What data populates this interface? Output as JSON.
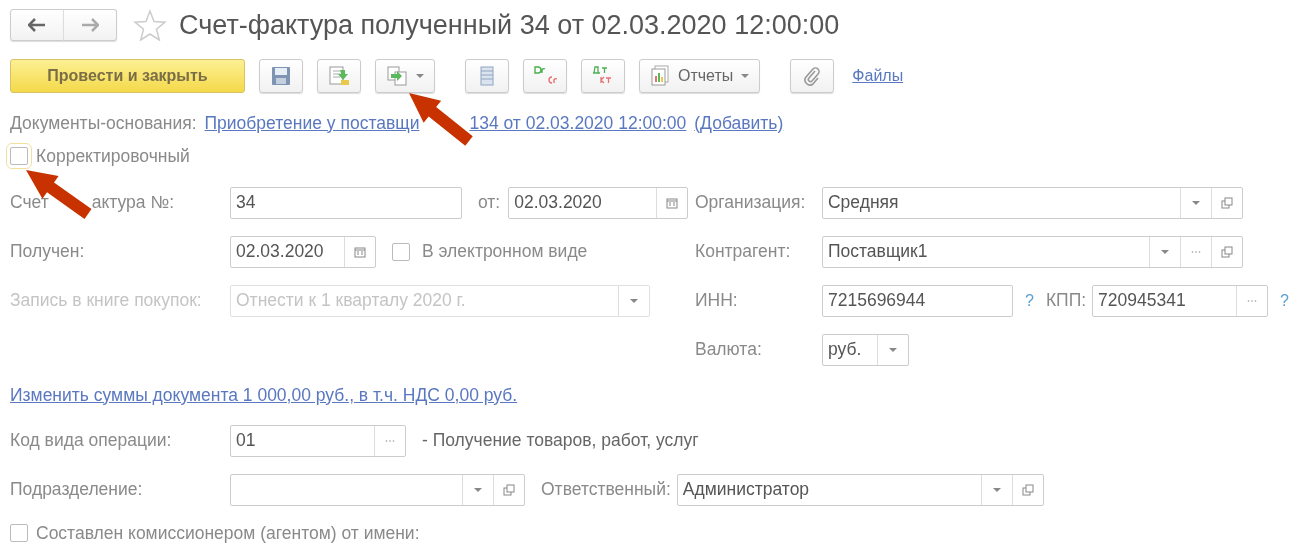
{
  "title": "Счет-фактура полученный 34 от 02.03.2020 12:00:00",
  "toolbar": {
    "primary_button": "Провести и закрыть",
    "reports_button": "Отчеты",
    "files_link": "Файлы"
  },
  "basis": {
    "label": "Документы-основания:",
    "link_start": "Приобретение у поставщи",
    "link_end": "134 от 02.03.2020 12:00:00",
    "add_link": "(Добавить)"
  },
  "corrective": {
    "label": "Корректировочный",
    "checked": false
  },
  "invoice": {
    "label_start": "Счет",
    "label_end": "актура №:",
    "value": "34",
    "date_label": "от:",
    "date": "02.03.2020"
  },
  "received": {
    "label": "Получен:",
    "date": "02.03.2020",
    "electronic": {
      "label": "В электронном виде",
      "checked": false
    }
  },
  "purchase_book": {
    "label": "Запись в книге покупок:",
    "value": "Отнести к 1 кварталу 2020 г.",
    "disabled": true
  },
  "organization": {
    "label": "Организация:",
    "value": "Средняя"
  },
  "counterparty": {
    "label": "Контрагент:",
    "value": "Поставщик1"
  },
  "tax_ids": {
    "inn_label": "ИНН:",
    "inn": "7215696944",
    "kpp_label": "КПП:",
    "kpp": "720945341",
    "help": "?"
  },
  "currency": {
    "label": "Валюта:",
    "value": "руб."
  },
  "sums_link": "Изменить суммы документа 1 000,00 руб., в т.ч. НДС 0,00 руб.",
  "operation_code": {
    "label": "Код вида операции:",
    "value": "01",
    "description": "- Получение товаров, работ, услуг"
  },
  "department": {
    "label": "Подразделение:"
  },
  "responsible": {
    "label": "Ответственный:",
    "value": "Администратор"
  },
  "commission": {
    "label": "Составлен комиссионером (агентом) от имени:",
    "checked": false
  }
}
